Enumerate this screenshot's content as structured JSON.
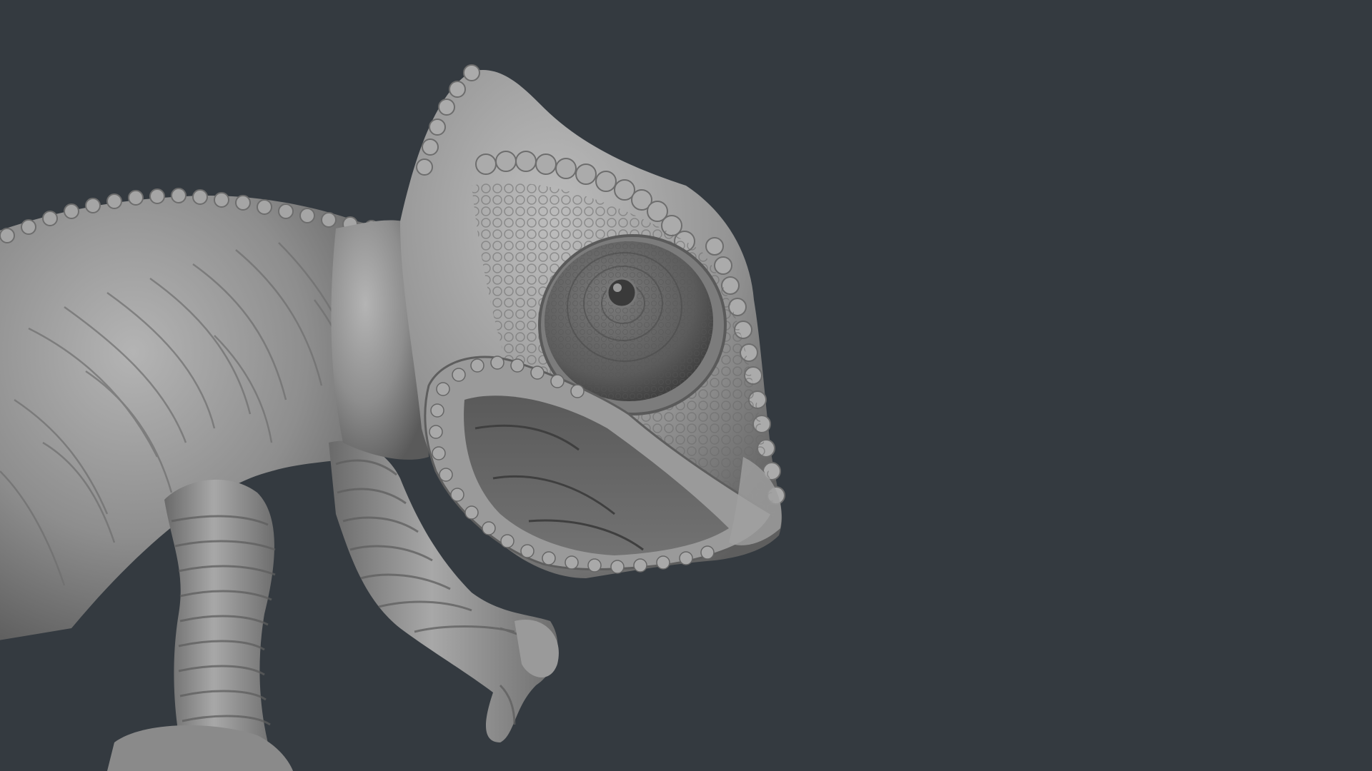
{
  "scene": {
    "background_color": "#343a40",
    "subject": "chameleon-sculpt",
    "material_color": "#8f8f8f",
    "highlight_color": "#c8c8c8",
    "shadow_color": "#4a4a4a"
  }
}
